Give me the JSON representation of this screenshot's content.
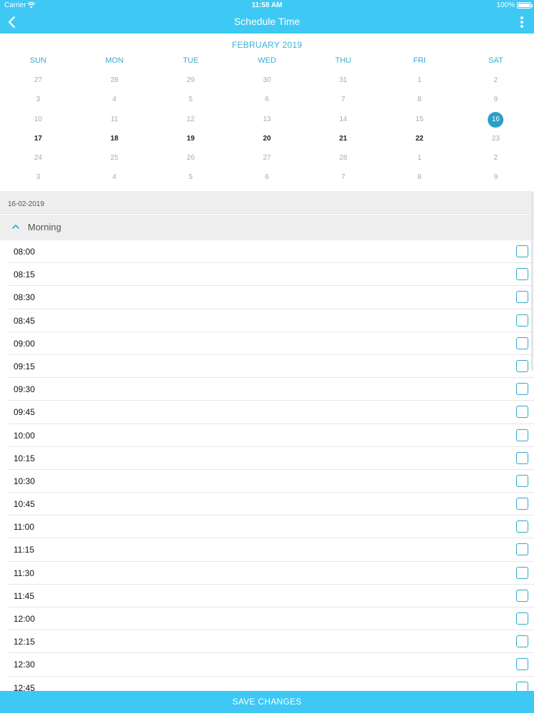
{
  "status": {
    "carrier": "Carrier",
    "time": "11:58 AM",
    "battery": "100%"
  },
  "nav": {
    "title": "Schedule Time",
    "back_icon": "chevron-left-icon",
    "more_icon": "more-vertical-icon"
  },
  "calendar": {
    "month": "FEBRUARY 2019",
    "weekdays": [
      "SUN",
      "MON",
      "TUE",
      "WED",
      "THU",
      "FRI",
      "SAT"
    ],
    "selected": "16",
    "weeks": [
      [
        {
          "d": "27",
          "s": "muted"
        },
        {
          "d": "28",
          "s": "muted"
        },
        {
          "d": "29",
          "s": "muted"
        },
        {
          "d": "30",
          "s": "muted"
        },
        {
          "d": "31",
          "s": "muted"
        },
        {
          "d": "1",
          "s": "muted"
        },
        {
          "d": "2",
          "s": "muted"
        }
      ],
      [
        {
          "d": "3",
          "s": "muted"
        },
        {
          "d": "4",
          "s": "muted"
        },
        {
          "d": "5",
          "s": "muted"
        },
        {
          "d": "6",
          "s": "muted"
        },
        {
          "d": "7",
          "s": "muted"
        },
        {
          "d": "8",
          "s": "muted"
        },
        {
          "d": "9",
          "s": "muted"
        }
      ],
      [
        {
          "d": "10",
          "s": "muted"
        },
        {
          "d": "11",
          "s": "muted"
        },
        {
          "d": "12",
          "s": "muted"
        },
        {
          "d": "13",
          "s": "muted"
        },
        {
          "d": "14",
          "s": "muted"
        },
        {
          "d": "15",
          "s": "muted"
        },
        {
          "d": "16",
          "s": "selected"
        }
      ],
      [
        {
          "d": "17",
          "s": "active"
        },
        {
          "d": "18",
          "s": "active"
        },
        {
          "d": "19",
          "s": "active"
        },
        {
          "d": "20",
          "s": "active"
        },
        {
          "d": "21",
          "s": "active"
        },
        {
          "d": "22",
          "s": "active"
        },
        {
          "d": "23",
          "s": "muted"
        }
      ],
      [
        {
          "d": "24",
          "s": "muted"
        },
        {
          "d": "25",
          "s": "muted"
        },
        {
          "d": "26",
          "s": "muted"
        },
        {
          "d": "27",
          "s": "muted"
        },
        {
          "d": "28",
          "s": "muted"
        },
        {
          "d": "1",
          "s": "muted"
        },
        {
          "d": "2",
          "s": "muted"
        }
      ],
      [
        {
          "d": "3",
          "s": "muted"
        },
        {
          "d": "4",
          "s": "muted"
        },
        {
          "d": "5",
          "s": "muted"
        },
        {
          "d": "6",
          "s": "muted"
        },
        {
          "d": "7",
          "s": "muted"
        },
        {
          "d": "8",
          "s": "muted"
        },
        {
          "d": "9",
          "s": "muted"
        }
      ]
    ]
  },
  "selected_date": "16-02-2019",
  "section": {
    "label": "Morning",
    "icon": "chevron-up-icon"
  },
  "slots": [
    "08:00",
    "08:15",
    "08:30",
    "08:45",
    "09:00",
    "09:15",
    "09:30",
    "09:45",
    "10:00",
    "10:15",
    "10:30",
    "10:45",
    "11:00",
    "11:15",
    "11:30",
    "11:45",
    "12:00",
    "12:15",
    "12:30",
    "12:45"
  ],
  "save_label": "SAVE CHANGES",
  "colors": {
    "accent": "#3ec8f4",
    "selected_day": "#2a9fc9",
    "checkbox": "#2fa8c9"
  }
}
